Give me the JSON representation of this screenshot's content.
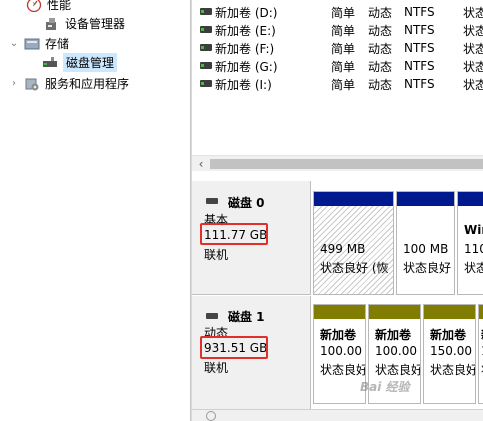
{
  "tree": {
    "items": [
      {
        "label": "性能",
        "icon": "performance-icon"
      },
      {
        "label": "设备管理器",
        "icon": "device-manager-icon"
      },
      {
        "label": "存储",
        "icon": "storage-icon"
      },
      {
        "label": "磁盘管理",
        "icon": "disk-management-icon"
      },
      {
        "label": "服务和应用程序",
        "icon": "services-icon"
      }
    ]
  },
  "volumes": [
    {
      "name": "新加卷 (D:)",
      "layout": "简单",
      "type": "动态",
      "fs": "NTFS",
      "status": "状态"
    },
    {
      "name": "新加卷 (E:)",
      "layout": "简单",
      "type": "动态",
      "fs": "NTFS",
      "status": "状态"
    },
    {
      "name": "新加卷 (F:)",
      "layout": "简单",
      "type": "动态",
      "fs": "NTFS",
      "status": "状态"
    },
    {
      "name": "新加卷 (G:)",
      "layout": "简单",
      "type": "动态",
      "fs": "NTFS",
      "status": "状态"
    },
    {
      "name": "新加卷 (I:)",
      "layout": "简单",
      "type": "动态",
      "fs": "NTFS",
      "status": "状态"
    }
  ],
  "disks": [
    {
      "name": "磁盘 0",
      "kind": "基本",
      "size": "111.77 GB",
      "state": "联机",
      "partitions": [
        {
          "title": "",
          "size": "499 MB",
          "status": "状态良好 (恢"
        },
        {
          "title": "",
          "size": "100 MB",
          "status": "状态良好"
        },
        {
          "title": "Wir",
          "size": "110",
          "status": "状态"
        }
      ]
    },
    {
      "name": "磁盘 1",
      "kind": "动态",
      "size": "931.51 GB",
      "state": "联机",
      "partitions": [
        {
          "title": "新加卷",
          "size": "100.00",
          "status": "状态良好"
        },
        {
          "title": "新加卷",
          "size": "100.00",
          "status": "状态良好"
        },
        {
          "title": "新加卷",
          "size": "150.00",
          "status": "状态良好"
        },
        {
          "title": "新",
          "size": "15",
          "status": "状"
        }
      ]
    }
  ],
  "watermark": "Bai 经验",
  "colors": {
    "primary_partition": "#00198f",
    "simple_volume": "#807d00",
    "highlight": "#e0302c",
    "selected_bg": "#cce8ff"
  }
}
